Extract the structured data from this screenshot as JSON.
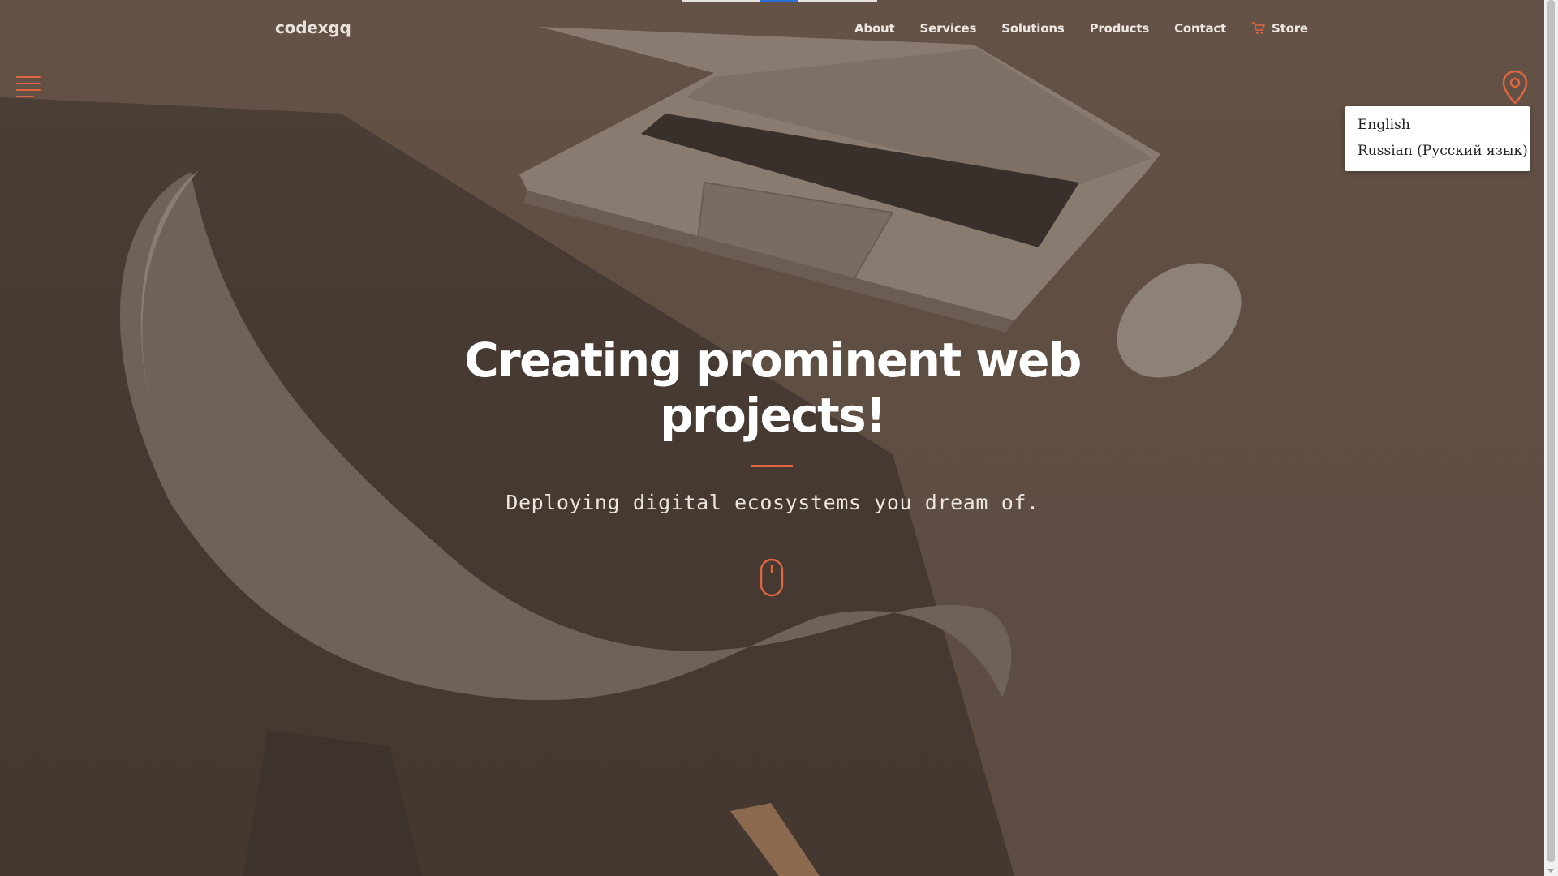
{
  "brand": {
    "logo": "codexgq",
    "accent_color": "#e0663f"
  },
  "nav": {
    "items": [
      {
        "label": "About"
      },
      {
        "label": "Services"
      },
      {
        "label": "Solutions"
      },
      {
        "label": "Products"
      },
      {
        "label": "Contact"
      },
      {
        "label": "Store",
        "icon": "cart-icon"
      }
    ]
  },
  "language_menu": {
    "trigger_icon": "map-pin-icon",
    "options": [
      {
        "label": "English"
      },
      {
        "label": "Russian (Русский язык)"
      }
    ]
  },
  "menu_toggle": {
    "icon": "hamburger-icon"
  },
  "hero": {
    "title": "Creating prominent web projects!",
    "subtitle": "Deploying digital ecosystems you dream of.",
    "scroll_icon": "mouse-scroll-icon"
  }
}
